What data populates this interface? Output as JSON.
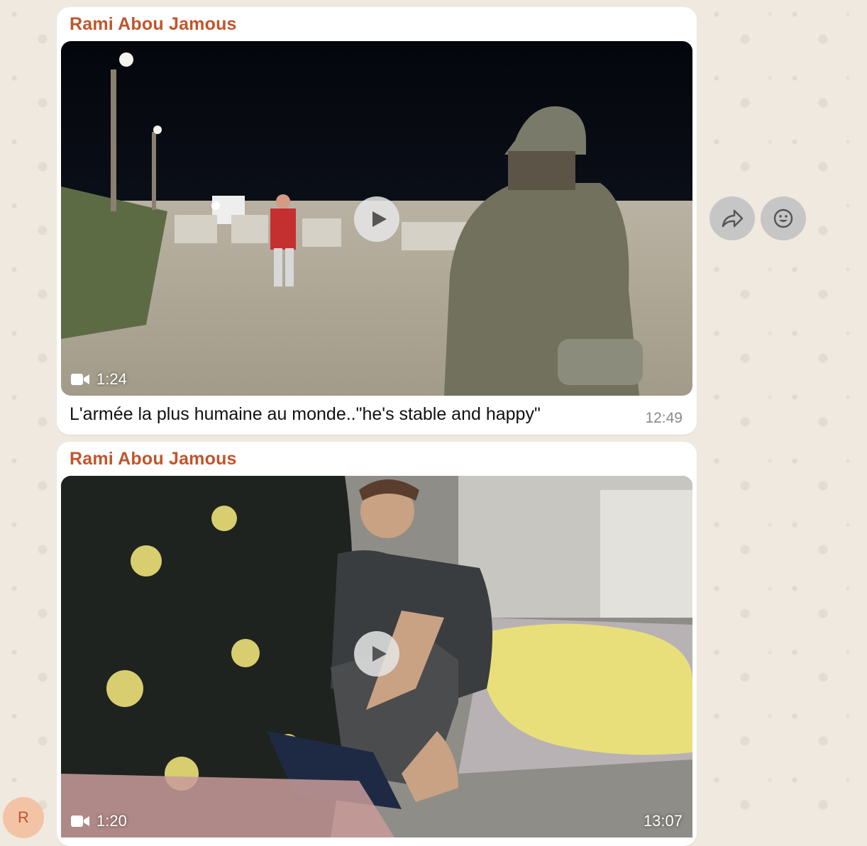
{
  "messages": [
    {
      "sender": "Rami Abou Jamous",
      "media_type": "video",
      "duration": "1:24",
      "caption": "L'armée la plus humaine au monde..\"he's stable and happy\"",
      "time": "12:49"
    },
    {
      "sender": "Rami Abou Jamous",
      "media_type": "video",
      "duration": "1:20",
      "time": "13:07"
    }
  ],
  "avatar": {
    "initial": "R"
  },
  "actions": {
    "forward_icon": "forward-icon",
    "react_icon": "smiley-icon"
  },
  "colors": {
    "sender_name": "#c0552b",
    "bubble": "#ffffff",
    "wallpaper": "#efe9df"
  }
}
